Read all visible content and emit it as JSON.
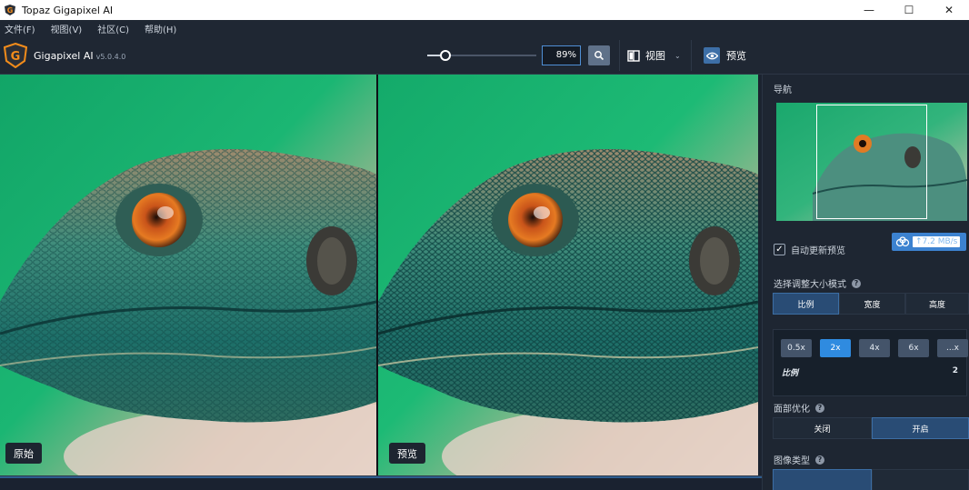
{
  "window": {
    "title": "Topaz Gigapixel AI",
    "minimize": "—",
    "maximize": "☐",
    "close": "✕"
  },
  "menu": [
    {
      "label": "文件(F)"
    },
    {
      "label": "视图(V)"
    },
    {
      "label": "社区(C)"
    },
    {
      "label": "帮助(H)"
    }
  ],
  "toolbar": {
    "brand": "Gigapixel AI",
    "version": "v5.0.4.0",
    "zoom_value": "89%",
    "zoom_fraction": 0.89,
    "view_label": "视图",
    "preview_label": "预览"
  },
  "panes": {
    "original_label": "原始",
    "preview_label": "预览"
  },
  "panel": {
    "navigator_title": "导航",
    "speed_badge": "↑7.2 MB/s",
    "auto_update_label": "自动更新预览",
    "auto_update_checked": true,
    "resize_mode_title": "选择调整大小模式",
    "resize_tabs": [
      {
        "label": "比例",
        "active": true
      },
      {
        "label": "宽度",
        "active": false
      },
      {
        "label": "高度",
        "active": false
      }
    ],
    "scale_options": [
      {
        "label": "0.5x",
        "active": false
      },
      {
        "label": "2x",
        "active": true
      },
      {
        "label": "4x",
        "active": false
      },
      {
        "label": "6x",
        "active": false
      },
      {
        "label": "...x",
        "active": false
      }
    ],
    "scale_label": "比例",
    "scale_value": "2",
    "face_title": "面部优化",
    "face_options": [
      {
        "label": "关闭",
        "active": false
      },
      {
        "label": "开启",
        "active": true
      }
    ],
    "image_type_title": "图像类型"
  }
}
